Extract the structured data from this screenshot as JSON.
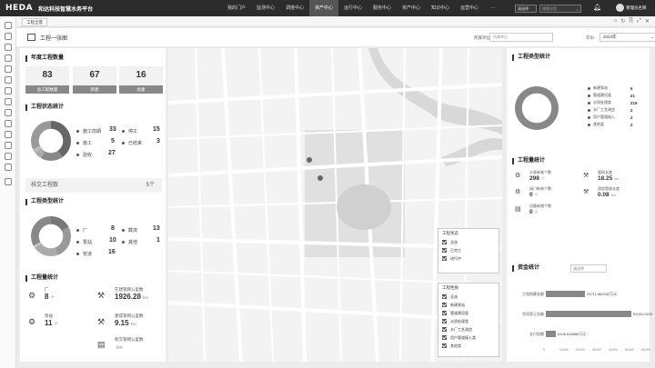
{
  "brand": {
    "logo": "HEDA",
    "title": "和达科技智慧水务平台"
  },
  "nav": {
    "items": [
      "我的门户",
      "监测中心",
      "调度中心",
      "资产中心",
      "运行中心",
      "服务中心",
      "资产中心",
      "知识中心",
      "运营中心"
    ],
    "active_index": 3,
    "more": "···"
  },
  "header_right": {
    "select": "请选择",
    "search_placeholder": "搜索应用",
    "user": "管理员名称"
  },
  "tabs": {
    "current": "工程全景"
  },
  "page": {
    "title": "工程一张图",
    "unit_label": "所属单位",
    "unit_placeholder": "所属单位",
    "year_label": "年份",
    "year_value": "2023年"
  },
  "annual": {
    "title": "年度工程数量",
    "cards": [
      {
        "num": "83",
        "label": "总工程数量"
      },
      {
        "num": "67",
        "label": "新建"
      },
      {
        "num": "16",
        "label": "续建"
      }
    ]
  },
  "status": {
    "title": "工程状态统计",
    "items": [
      {
        "label": "施工前期",
        "value": "33"
      },
      {
        "label": "停工",
        "value": "15"
      },
      {
        "label": "施工",
        "value": "5"
      },
      {
        "label": "已结束",
        "value": "3"
      },
      {
        "label": "验收",
        "value": "27"
      }
    ],
    "checked_row": {
      "label": "核交工程数",
      "count": "5个"
    }
  },
  "types": {
    "title": "工程类型统计",
    "items": [
      {
        "label": "厂",
        "value": "8"
      },
      {
        "label": "截流",
        "value": "13"
      },
      {
        "label": "泵站",
        "value": "10"
      },
      {
        "label": "其他",
        "value": "1"
      },
      {
        "label": "管道",
        "value": "16"
      }
    ]
  },
  "quantity": {
    "title": "工程量统计",
    "items": [
      {
        "label": "厂",
        "value": "8",
        "unit": "个"
      },
      {
        "label": "在建管网公里数",
        "value": "1926.28",
        "unit": "km"
      },
      {
        "label": "泵站",
        "value": "11",
        "unit": "个"
      },
      {
        "label": "建成管网公里数",
        "value": "9.15",
        "unit": "km"
      },
      {
        "label": "移交管网公里数",
        "value": "",
        "unit": "km"
      }
    ]
  },
  "map_filters": {
    "status_title": "工程状态",
    "status": [
      "全选",
      "已完工",
      "进行中"
    ],
    "type_title": "工程性质",
    "types": [
      "全选",
      "新建泵站",
      "管道建设类",
      "水质处理类",
      "水厂工艺改造",
      "用户管道接入类",
      "其他类"
    ]
  },
  "right_types": {
    "title": "工程类型统计",
    "items": [
      {
        "label": "新建泵站",
        "value": "6"
      },
      {
        "label": "管道建设类",
        "value": "21"
      },
      {
        "label": "水质处理类",
        "value": "219"
      },
      {
        "label": "水厂工艺改造",
        "value": "2"
      },
      {
        "label": "用户管道接入",
        "value": "2"
      },
      {
        "label": "其他类",
        "value": "2"
      }
    ]
  },
  "right_quantity": {
    "title": "工程量统计",
    "items": [
      {
        "label": "水表新装个数",
        "value": "298",
        "unit": "个"
      },
      {
        "label": "管网长度",
        "value": "18.25",
        "unit": "km"
      },
      {
        "label": "阀门新装个数",
        "value": "0",
        "unit": "个"
      },
      {
        "label": "改造管道长度",
        "value": "0.08",
        "unit": "km"
      },
      {
        "label": "设备新增个数",
        "value": "0",
        "unit": "个"
      }
    ]
  },
  "fund": {
    "title": "资金统计",
    "select_placeholder": "请选择",
    "rows": [
      {
        "label": "工程结算金额",
        "value": "23711.862042万元",
        "amount": 23711.862042
      },
      {
        "label": "合同签订金额",
        "value": "52031.0153",
        "amount": 52031.0153
      },
      {
        "label": "支付金额",
        "value": "6106.518586万元",
        "amount": 6106.518586
      }
    ],
    "axis": [
      "0",
      "10,000",
      "20,000",
      "30,000",
      "40,000",
      "50,000",
      "60,000"
    ],
    "max": 60000
  },
  "icons": [
    "home-icon",
    "search-icon",
    "bell-icon",
    "chevron-down-icon",
    "map-pin-icon",
    "pump-icon",
    "pipe-icon",
    "document-icon",
    "settings-icon",
    "refresh-icon",
    "fullscreen-icon"
  ]
}
